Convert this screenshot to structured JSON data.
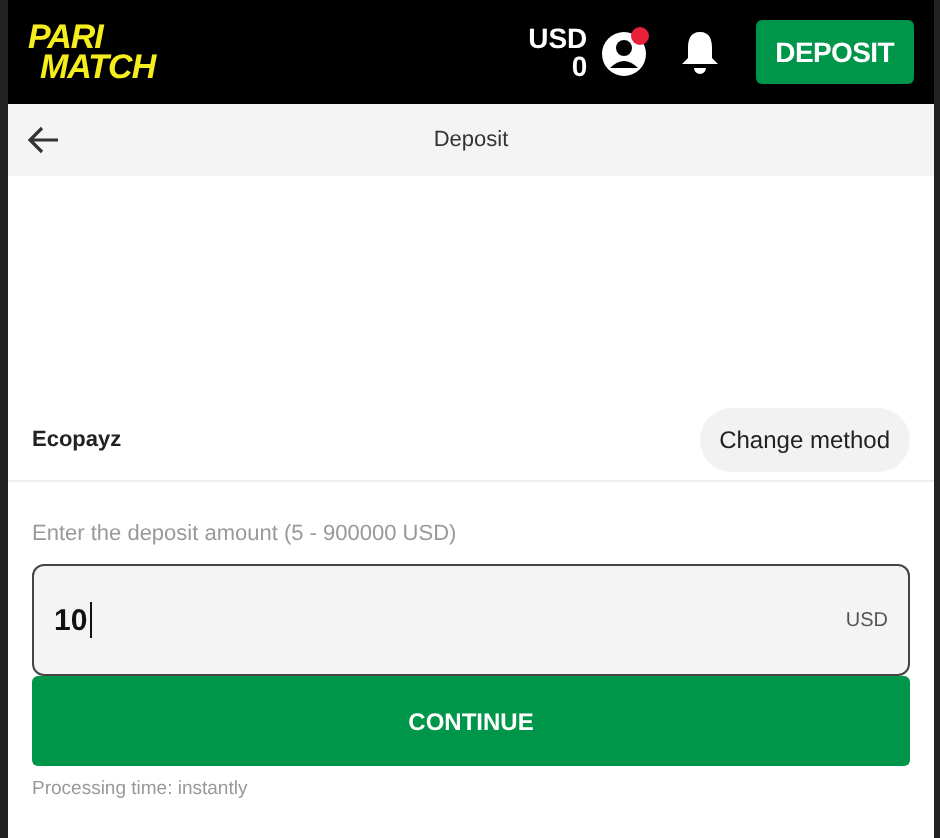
{
  "header": {
    "logo": [
      "PARI",
      "MATCH"
    ],
    "balance": {
      "currency": "USD",
      "amount": "0"
    },
    "has_notification": true,
    "deposit_button": "DEPOSIT"
  },
  "subheader": {
    "title": "Deposit"
  },
  "method": {
    "name": "Ecopayz",
    "change_button": "Change method"
  },
  "amount": {
    "label": "Enter the deposit amount (5 - 900000 USD)",
    "value": "10",
    "currency": "USD"
  },
  "continue_button": "CONTINUE",
  "note": "Processing time: instantly"
}
